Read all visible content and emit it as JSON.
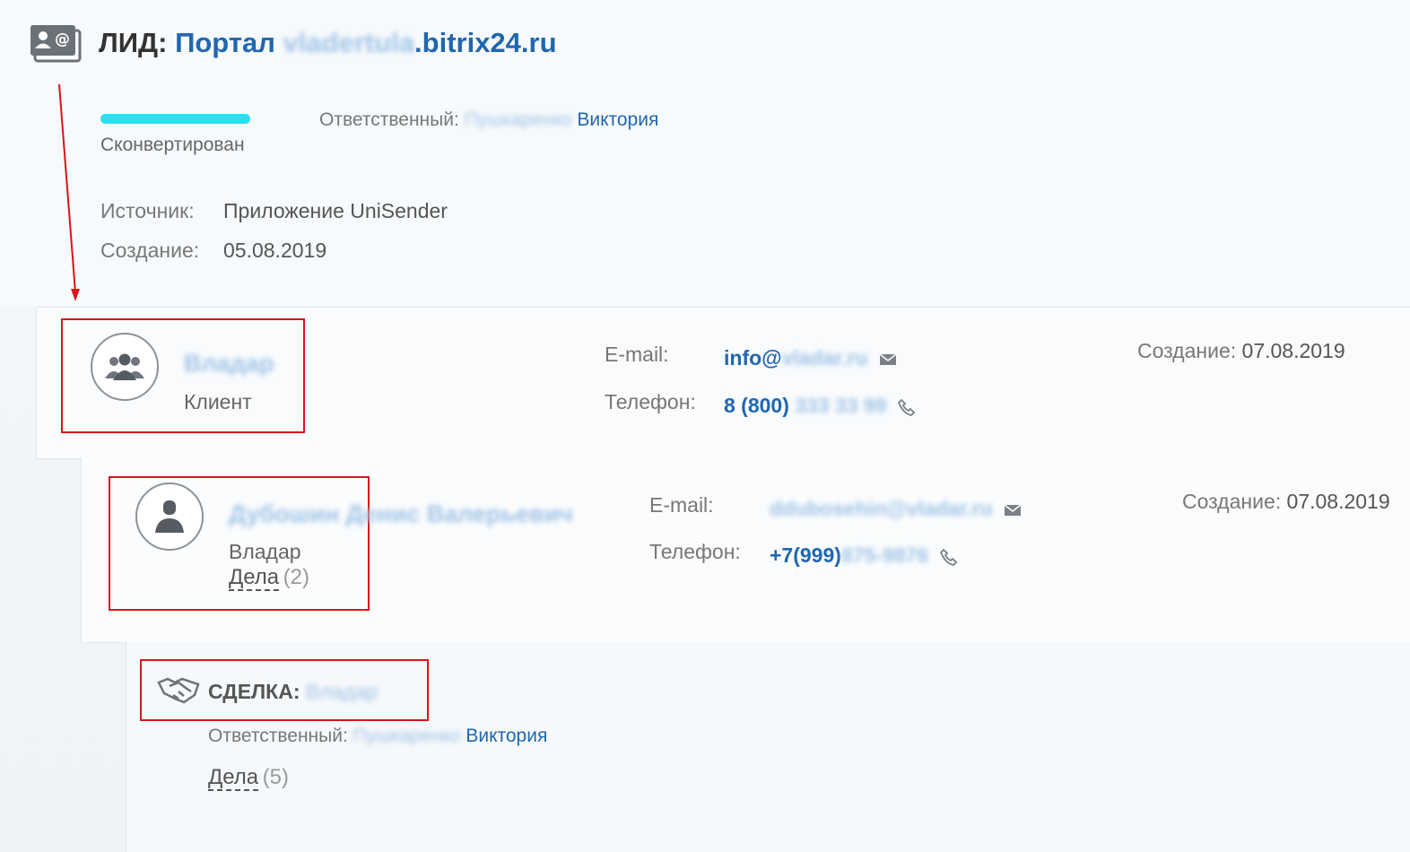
{
  "lead": {
    "prefix": "ЛИД:",
    "title_start": "Портал",
    "title_blurred": "vladertula",
    "title_domain": ".bitrix24.ru",
    "status": "Сконвертирован",
    "responsible_label": "Ответственный:",
    "responsible_blurred": "Пушкаренко",
    "responsible_name": "Виктория",
    "source_label": "Источник:",
    "source_value": "Приложение UniSender",
    "created_label": "Создание:",
    "created_value": "05.08.2019"
  },
  "client": {
    "name_blurred": "Владар",
    "type": "Клиент",
    "email_label": "E-mail:",
    "email_start": "info@",
    "email_blurred": "vladar.ru",
    "phone_label": "Телефон:",
    "phone_start": "8 (800)",
    "phone_blurred": "333 33 99",
    "created_label": "Создание:",
    "created_value": "07.08.2019"
  },
  "contact": {
    "name_blurred": "Дубошин Денис Валерьевич",
    "company": "Владар",
    "tasks_label": "Дела",
    "tasks_count": "(2)",
    "email_label": "E-mail:",
    "email_blurred": "ddubosehin@vladar.ru",
    "phone_label": "Телефон:",
    "phone_start": "+7(999)",
    "phone_blurred": "875-9876",
    "created_label": "Создание:",
    "created_value": "07.08.2019"
  },
  "deal": {
    "prefix": "СДЕЛКА:",
    "name_blurred": "Владар",
    "responsible_label": "Ответственный:",
    "responsible_blurred": "Пушкаренко",
    "responsible_name": "Виктория",
    "tasks_label": "Дела",
    "tasks_count": "(5)"
  },
  "colors": {
    "accent": "#2067b0",
    "progress": "#28e1f0",
    "highlight": "#d9141c"
  }
}
